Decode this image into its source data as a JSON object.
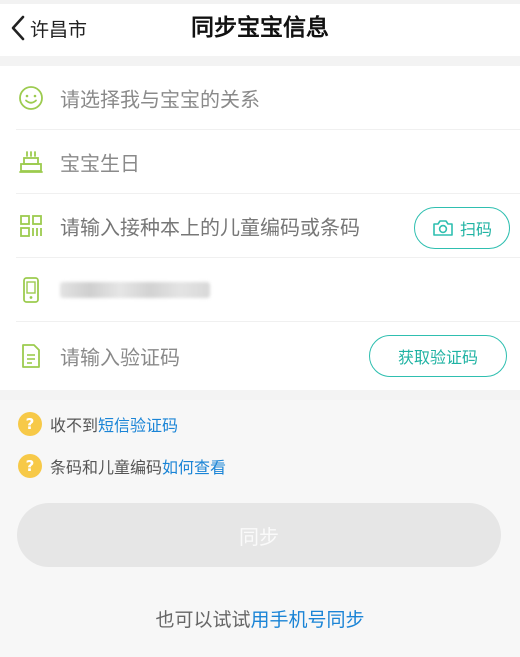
{
  "header": {
    "back_label": "许昌市",
    "title": "同步宝宝信息"
  },
  "form": {
    "relation": {
      "placeholder": "请选择我与宝宝的关系",
      "icon": "smiley-icon"
    },
    "birthday": {
      "placeholder": "宝宝生日",
      "icon": "cake-icon"
    },
    "code": {
      "placeholder": "请输入接种本上的儿童编码或条码",
      "icon": "qr-code-icon",
      "scan_label": "扫码"
    },
    "phone": {
      "icon": "phone-icon",
      "value_obscured": true
    },
    "verify": {
      "placeholder": "请输入验证码",
      "icon": "document-icon",
      "button_label": "获取验证码"
    }
  },
  "help": {
    "sms": {
      "prefix": "收不到",
      "link": "短信验证码"
    },
    "barcode": {
      "prefix": "条码和儿童编码",
      "link": "如何查看"
    }
  },
  "actions": {
    "sync_label": "同步",
    "alt_prefix": "也可以试试",
    "alt_link": "用手机号同步"
  },
  "colors": {
    "icon_green": "#9ccb4f",
    "accent_teal": "#2fbfb0",
    "link_blue": "#1a84d6",
    "help_yellow": "#f7c948",
    "button_disabled": "#e6e6e6"
  }
}
